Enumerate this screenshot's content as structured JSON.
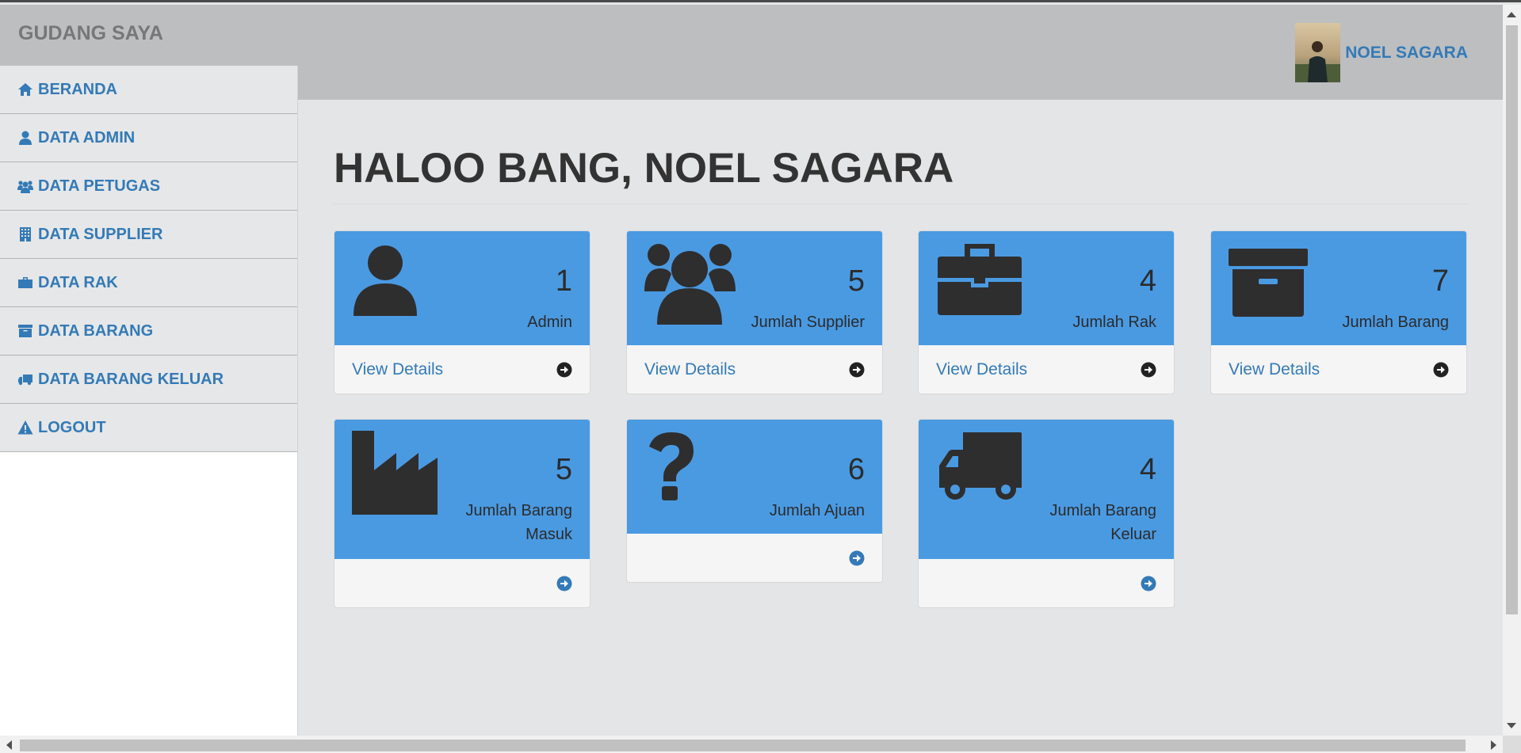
{
  "header": {
    "brand": "GUDANG SAYA",
    "user_name": "NOEL SAGARA"
  },
  "sidebar": {
    "items": [
      {
        "label": "BERANDA",
        "icon": "home-icon"
      },
      {
        "label": "DATA ADMIN",
        "icon": "user-icon"
      },
      {
        "label": "DATA PETUGAS",
        "icon": "users-icon"
      },
      {
        "label": "DATA SUPPLIER",
        "icon": "building-icon"
      },
      {
        "label": "DATA RAK",
        "icon": "briefcase-icon"
      },
      {
        "label": "DATA BARANG",
        "icon": "archive-icon"
      },
      {
        "label": "DATA BARANG KELUAR",
        "icon": "truck-icon"
      },
      {
        "label": "LOGOUT",
        "icon": "warning-icon"
      }
    ]
  },
  "main": {
    "title": "HALOO BANG, NOEL SAGARA",
    "cards": [
      {
        "count": "1",
        "label": "Admin",
        "link": "View Details",
        "icon": "user-icon"
      },
      {
        "count": "5",
        "label": "Jumlah Supplier",
        "link": "View Details",
        "icon": "users-icon"
      },
      {
        "count": "4",
        "label": "Jumlah Rak",
        "link": "View Details",
        "icon": "briefcase-icon"
      },
      {
        "count": "7",
        "label": "Jumlah Barang",
        "link": "View Details",
        "icon": "archive-icon"
      },
      {
        "count": "5",
        "label": "Jumlah Barang Masuk",
        "link": "",
        "icon": "industry-icon"
      },
      {
        "count": "6",
        "label": "Jumlah Ajuan",
        "link": "",
        "icon": "question-icon"
      },
      {
        "count": "4",
        "label": "Jumlah Barang Keluar",
        "link": "",
        "icon": "truck-icon"
      }
    ]
  },
  "colors": {
    "accent": "#4a9ae2",
    "link": "#337ab7",
    "header_bg": "#bdbec0"
  }
}
